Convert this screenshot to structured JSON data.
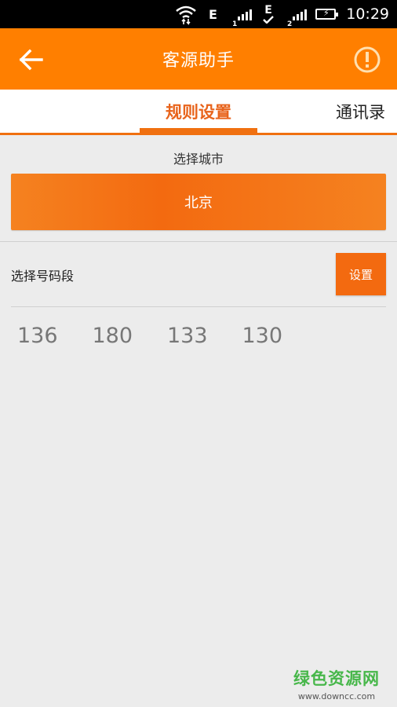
{
  "status_bar": {
    "network_label_1": "E",
    "signal_num_1": "1",
    "network_label_2": "E",
    "signal_num_2": "2",
    "time": "10:29"
  },
  "app_bar": {
    "title": "客源助手"
  },
  "tabs": [
    {
      "label": "规则设置",
      "active": true
    },
    {
      "label": "通讯录",
      "active": false
    }
  ],
  "city": {
    "label": "选择城市",
    "selected": "北京"
  },
  "segment": {
    "label": "选择号码段",
    "button_label": "设置",
    "prefixes": [
      "136",
      "180",
      "133",
      "130"
    ]
  },
  "watermark": {
    "name": "绿色资源网",
    "url": "www.downcc.com"
  },
  "colors": {
    "accent": "#ff7f00",
    "accent_dark": "#f36a10",
    "tab_active": "#e8641c",
    "background": "#ececec"
  }
}
